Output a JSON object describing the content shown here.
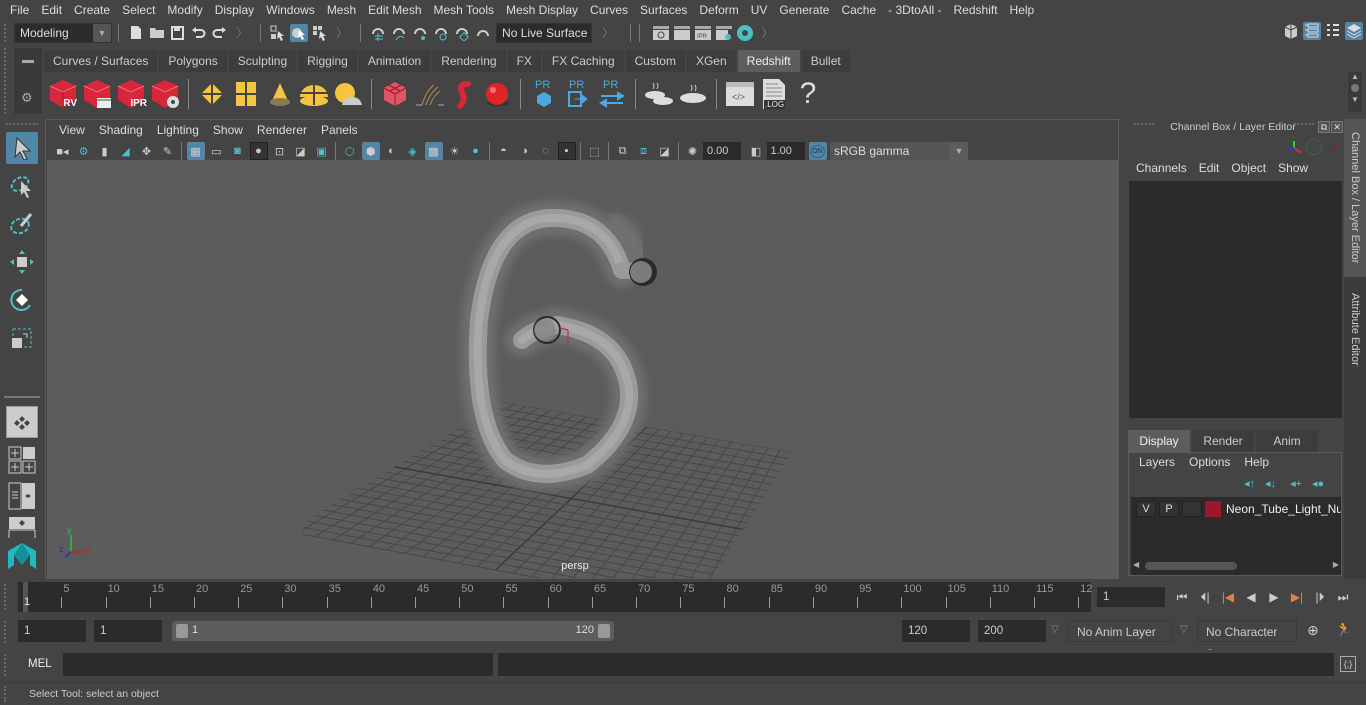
{
  "menubar": {
    "items": [
      "File",
      "Edit",
      "Create",
      "Select",
      "Modify",
      "Display",
      "Windows",
      "Mesh",
      "Edit Mesh",
      "Mesh Tools",
      "Mesh Display",
      "Curves",
      "Surfaces",
      "Deform",
      "UV",
      "Generate",
      "Cache",
      "- 3DtoAll -",
      "Redshift",
      "Help"
    ]
  },
  "statusline": {
    "menuset": "Modeling",
    "live_surface": "No Live Surface"
  },
  "shelf": {
    "tabs": [
      "Curves / Surfaces",
      "Polygons",
      "Sculpting",
      "Rigging",
      "Animation",
      "Rendering",
      "FX",
      "FX Caching",
      "Custom",
      "XGen",
      "Redshift",
      "Bullet"
    ],
    "active_tab": "Redshift",
    "icon_labels": {
      "rv": "RV",
      "ipr": "IPR",
      "pr": "PR",
      "log": ".LOG",
      "help": "?"
    }
  },
  "panel": {
    "menus": [
      "View",
      "Shading",
      "Lighting",
      "Show",
      "Renderer",
      "Panels"
    ],
    "exposure": "0.00",
    "gamma": "1.00",
    "colorspace_toggle": "ON",
    "colorspace": "sRGB gamma",
    "camera_label": "persp",
    "axis": {
      "x": "x",
      "y": "y",
      "z": "z"
    }
  },
  "channelbox": {
    "title": "Channel Box / Layer Editor",
    "menus": [
      "Channels",
      "Edit",
      "Object",
      "Show"
    ],
    "layer_tabs": [
      "Display",
      "Render",
      "Anim"
    ],
    "active_layer_tab": "Display",
    "layer_menus": [
      "Layers",
      "Options",
      "Help"
    ],
    "layers": [
      {
        "visible": "V",
        "playback": "P",
        "name": "Neon_Tube_Light_Nur",
        "color": "#a0142c"
      }
    ]
  },
  "side_tabs": [
    "Channel Box / Layer Editor",
    "Attribute Editor"
  ],
  "timeline": {
    "ticks": [
      "5",
      "10",
      "15",
      "20",
      "25",
      "30",
      "35",
      "40",
      "45",
      "50",
      "55",
      "60",
      "65",
      "70",
      "75",
      "80",
      "85",
      "90",
      "95",
      "100",
      "105",
      "110",
      "115",
      "12"
    ],
    "current_frame_marker": "1",
    "current_frame": "1"
  },
  "range": {
    "start": "1",
    "anim_start": "1",
    "slider_start": "1",
    "slider_end": "120",
    "anim_end": "120",
    "end": "200",
    "anim_layer": "No Anim Layer",
    "character_set": "No Character Set"
  },
  "commandline": {
    "language": "MEL",
    "input": "",
    "output": ""
  },
  "helpline": {
    "text": "Select Tool: select an object"
  },
  "colors": {
    "accent": "#5285a6",
    "redshift_red": "#d9263a",
    "maya_teal": "#1fb8c3",
    "highlight_yellow": "#f5c542"
  }
}
